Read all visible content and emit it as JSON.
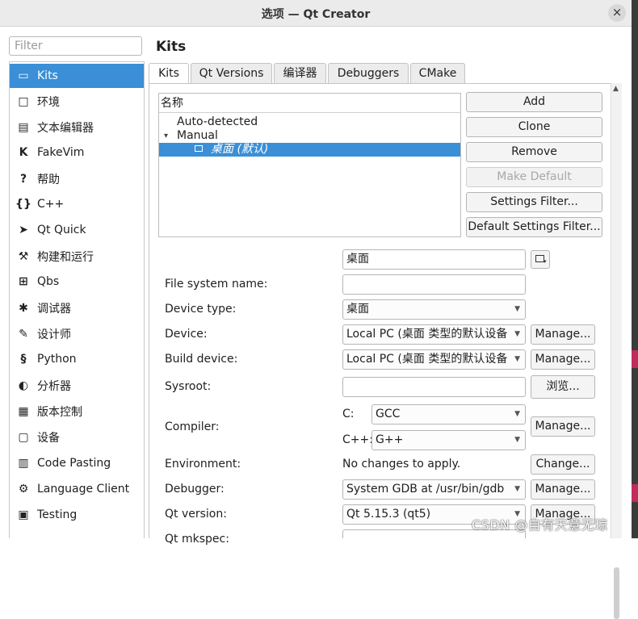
{
  "window": {
    "title": "选项 — Qt Creator",
    "close_glyph": "×"
  },
  "filter": {
    "placeholder": "Filter",
    "value": ""
  },
  "categories": [
    {
      "label": "Kits",
      "icon": "kits-icon",
      "glyph": "▭",
      "selected": true
    },
    {
      "label": "环境",
      "icon": "monitor-icon",
      "glyph": "□"
    },
    {
      "label": "文本编辑器",
      "icon": "text-editor-icon",
      "glyph": "▤"
    },
    {
      "label": "FakeVim",
      "icon": "fakevim-icon",
      "glyph": "K"
    },
    {
      "label": "帮助",
      "icon": "help-icon",
      "glyph": "?"
    },
    {
      "label": "C++",
      "icon": "cpp-braces-icon",
      "glyph": "{}"
    },
    {
      "label": "Qt Quick",
      "icon": "qt-quick-arrow-icon",
      "glyph": "➤"
    },
    {
      "label": "构建和运行",
      "icon": "hammer-icon",
      "glyph": "⚒"
    },
    {
      "label": "Qbs",
      "icon": "qbs-icon",
      "glyph": "⊞"
    },
    {
      "label": "调试器",
      "icon": "bug-icon",
      "glyph": "✱"
    },
    {
      "label": "设计师",
      "icon": "pencil-icon",
      "glyph": "✎"
    },
    {
      "label": "Python",
      "icon": "python-icon",
      "glyph": "§"
    },
    {
      "label": "分析器",
      "icon": "analyzer-icon",
      "glyph": "◐"
    },
    {
      "label": "版本控制",
      "icon": "version-control-icon",
      "glyph": "▦"
    },
    {
      "label": "设备",
      "icon": "device-icon",
      "glyph": "▢"
    },
    {
      "label": "Code Pasting",
      "icon": "code-pasting-icon",
      "glyph": "▥"
    },
    {
      "label": "Language Client",
      "icon": "language-client-icon",
      "glyph": "⚙"
    },
    {
      "label": "Testing",
      "icon": "testing-icon",
      "glyph": "▣"
    }
  ],
  "page_title": "Kits",
  "tabs": [
    "Kits",
    "Qt Versions",
    "编译器",
    "Debuggers",
    "CMake"
  ],
  "tree": {
    "header": "名称",
    "rows": [
      {
        "label": "Auto-detected",
        "expander": ""
      },
      {
        "label": "Manual",
        "expander": "▾"
      },
      {
        "label": "桌面 (默认)",
        "expander": "",
        "selected": true
      }
    ]
  },
  "kit_buttons": {
    "add": "Add",
    "clone": "Clone",
    "remove": "Remove",
    "make_default": "Make Default",
    "settings_filter": "Settings Filter...",
    "default_settings_filter": "Default Settings Filter..."
  },
  "form": {
    "name_value": "桌面",
    "fs_name_label": "File system name:",
    "fs_name_value": "",
    "device_type_label": "Device type:",
    "device_type_value": "桌面",
    "device_label": "Device:",
    "device_value": "Local PC (桌面 类型的默认设备",
    "build_device_label": "Build device:",
    "build_device_value": "Local PC (桌面 类型的默认设备",
    "sysroot_label": "Sysroot:",
    "sysroot_value": "",
    "browse_label": "浏览...",
    "compiler_label": "Compiler:",
    "c_label": "C:",
    "c_value": "GCC",
    "cpp_label": "C++:",
    "cpp_value": "G++",
    "environment_label": "Environment:",
    "environment_value": "No changes to apply.",
    "change_label": "Change...",
    "debugger_label": "Debugger:",
    "debugger_value": "System GDB at /usr/bin/gdb",
    "qt_version_label": "Qt version:",
    "qt_version_value": "Qt 5.15.3 (qt5)",
    "qt_mkspec_label": "Qt mkspec:",
    "manage_label": "Manage..."
  },
  "watermark": "CSDN @自有天意无琼",
  "colors": {
    "selection": "#3a8fd6",
    "right_strip": "#3b3b3b",
    "right_strip_marks": "#c02c5c"
  }
}
